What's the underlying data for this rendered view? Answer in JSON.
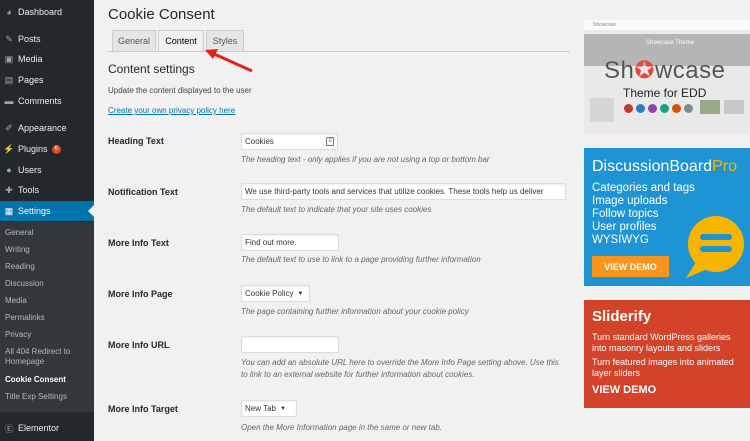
{
  "sidebar": {
    "items": [
      {
        "label": "Dashboard",
        "icon": "dashboard-icon"
      },
      {
        "label": "Posts",
        "icon": "pin-icon"
      },
      {
        "label": "Media",
        "icon": "media-icon"
      },
      {
        "label": "Pages",
        "icon": "page-icon"
      },
      {
        "label": "Comments",
        "icon": "comment-icon"
      },
      {
        "label": "Appearance",
        "icon": "brush-icon"
      },
      {
        "label": "Plugins",
        "icon": "plug-icon",
        "badge": "6"
      },
      {
        "label": "Users",
        "icon": "user-icon"
      },
      {
        "label": "Tools",
        "icon": "wrench-icon"
      },
      {
        "label": "Settings",
        "icon": "settings-icon",
        "active": true
      }
    ],
    "submenu": [
      "General",
      "Writing",
      "Reading",
      "Discussion",
      "Media",
      "Permalinks",
      "Privacy",
      "All 404 Redirect to Homepage",
      "Cookie Consent",
      "Title Exp Settings"
    ],
    "submenu_current": "Cookie Consent",
    "bottom_item": {
      "label": "Elementor",
      "icon": "elementor-icon"
    }
  },
  "main": {
    "title": "Cookie Consent",
    "tabs": [
      {
        "label": "General",
        "active": false
      },
      {
        "label": "Content",
        "active": true
      },
      {
        "label": "Styles",
        "active": false
      }
    ],
    "section_title": "Content settings",
    "section_desc": "Update the content displayed to the user",
    "privacy_link": "Create your own privacy policy here",
    "rows": {
      "heading": {
        "label": "Heading Text",
        "value": "Cookies",
        "hint": "The heading text - only applies if you are not using a top or bottom bar"
      },
      "notification": {
        "label": "Notification Text",
        "value": "We use third-party tools and services that utilize cookies. These tools help us deliver",
        "hint": "The default text to indicate that your site uses cookies"
      },
      "more_info_text": {
        "label": "More Info Text",
        "value": "Find out more.",
        "hint": "The default text to use to link to a page providing further information"
      },
      "more_info_page": {
        "label": "More Info Page",
        "value": "Cookie Policy",
        "hint": "The page containing further information about your cookie policy"
      },
      "more_info_url": {
        "label": "More Info URL",
        "value": "",
        "hint": "You can add an absolute URL here to override the More Info Page setting above. Use this to link to an external website for further information about cookies."
      },
      "more_info_target": {
        "label": "More Info Target",
        "value": "New Tab",
        "hint": "Open the More Information page in the same or new tab."
      }
    }
  },
  "ads": {
    "showcase": {
      "logo": "Showcase",
      "banner_text": "Showcase Theme",
      "title_a": "Sh",
      "title_b": "wcase",
      "subtitle": "Theme for EDD"
    },
    "discussion": {
      "title_a": "DiscussionBoard",
      "title_b": "Pro",
      "features": [
        "Categories and tags",
        "Image uploads",
        "Follow topics",
        "User profiles",
        "WYSIWYG"
      ],
      "button": "VIEW DEMO"
    },
    "sliderify": {
      "title": "Sliderify",
      "line1": "Turn standard WordPress galleries into masonry layouts and sliders",
      "line2": "Turn featured images into animated layer sliders",
      "button": "VIEW DEMO"
    }
  },
  "colors": {
    "accent": "#0073aa",
    "sidebar": "#23282d",
    "arrow": "#e2231a",
    "dbp_blue": "#1e94d4",
    "sliderify_red": "#d2432a"
  }
}
